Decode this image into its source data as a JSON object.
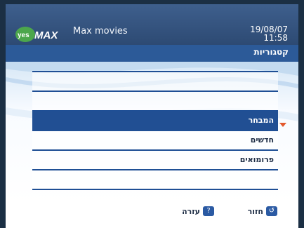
{
  "header": {
    "logo_text": "yesMAX",
    "app_title": "Max movies",
    "date": "19/08/07",
    "time": "11:58"
  },
  "subheader": {
    "label": "קטגוריות"
  },
  "list": {
    "items": [
      {
        "label": ""
      },
      {
        "label": ""
      },
      {
        "label": "המבחר"
      },
      {
        "label": "חדשים"
      },
      {
        "label": "פרומואים"
      },
      {
        "label": ""
      }
    ],
    "selected_index": 2
  },
  "footer": {
    "back_label": "חזור",
    "help_label": "עזרה",
    "help_icon_text": "?"
  },
  "colors": {
    "accent": "#214f93",
    "header": "#2d4a73",
    "arrow": "#e35a2e",
    "logo_green": "#4ca64c"
  }
}
